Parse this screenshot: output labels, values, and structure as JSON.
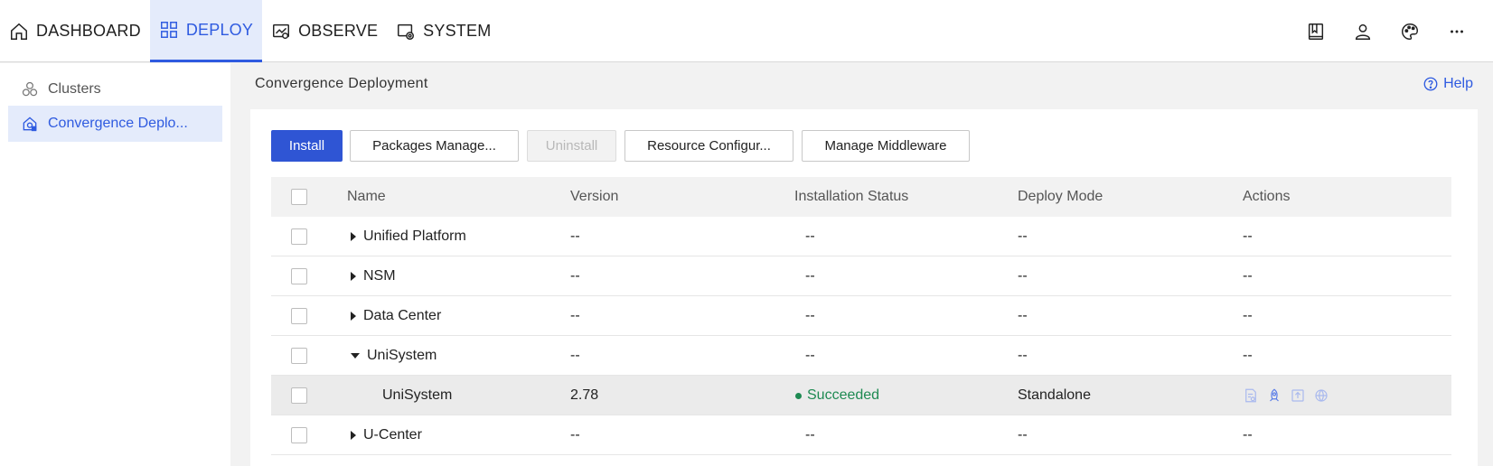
{
  "nav": {
    "items": [
      {
        "label": "DASHBOARD"
      },
      {
        "label": "DEPLOY"
      },
      {
        "label": "OBSERVE"
      },
      {
        "label": "SYSTEM"
      }
    ],
    "right_icons": [
      "book-icon",
      "user-icon",
      "palette-icon",
      "more-icon"
    ]
  },
  "sidebar": {
    "items": [
      {
        "label": "Clusters"
      },
      {
        "label": "Convergence Deplo..."
      }
    ]
  },
  "page": {
    "title": "Convergence Deployment",
    "help": "Help"
  },
  "toolbar": {
    "install": "Install",
    "packages": "Packages Manage...",
    "uninstall": "Uninstall",
    "resource": "Resource Configur...",
    "middleware": "Manage Middleware"
  },
  "table": {
    "headers": {
      "name": "Name",
      "version": "Version",
      "status": "Installation Status",
      "mode": "Deploy Mode",
      "actions": "Actions"
    },
    "rows": [
      {
        "name": "Unified Platform",
        "version": "--",
        "status": "--",
        "mode": "--",
        "actions": "--"
      },
      {
        "name": "NSM",
        "version": "--",
        "status": "--",
        "mode": "--",
        "actions": "--"
      },
      {
        "name": "Data Center",
        "version": "--",
        "status": "--",
        "mode": "--",
        "actions": "--"
      },
      {
        "name": "UniSystem",
        "version": "--",
        "status": "--",
        "mode": "--",
        "actions": "--"
      },
      {
        "name": "UniSystem",
        "version": "2.78",
        "status": "Succeeded",
        "mode": "Standalone"
      },
      {
        "name": "U-Center",
        "version": "--",
        "status": "--",
        "mode": "--",
        "actions": "--"
      }
    ]
  },
  "colors": {
    "accent": "#2f5be0",
    "success": "#1e8a52"
  }
}
